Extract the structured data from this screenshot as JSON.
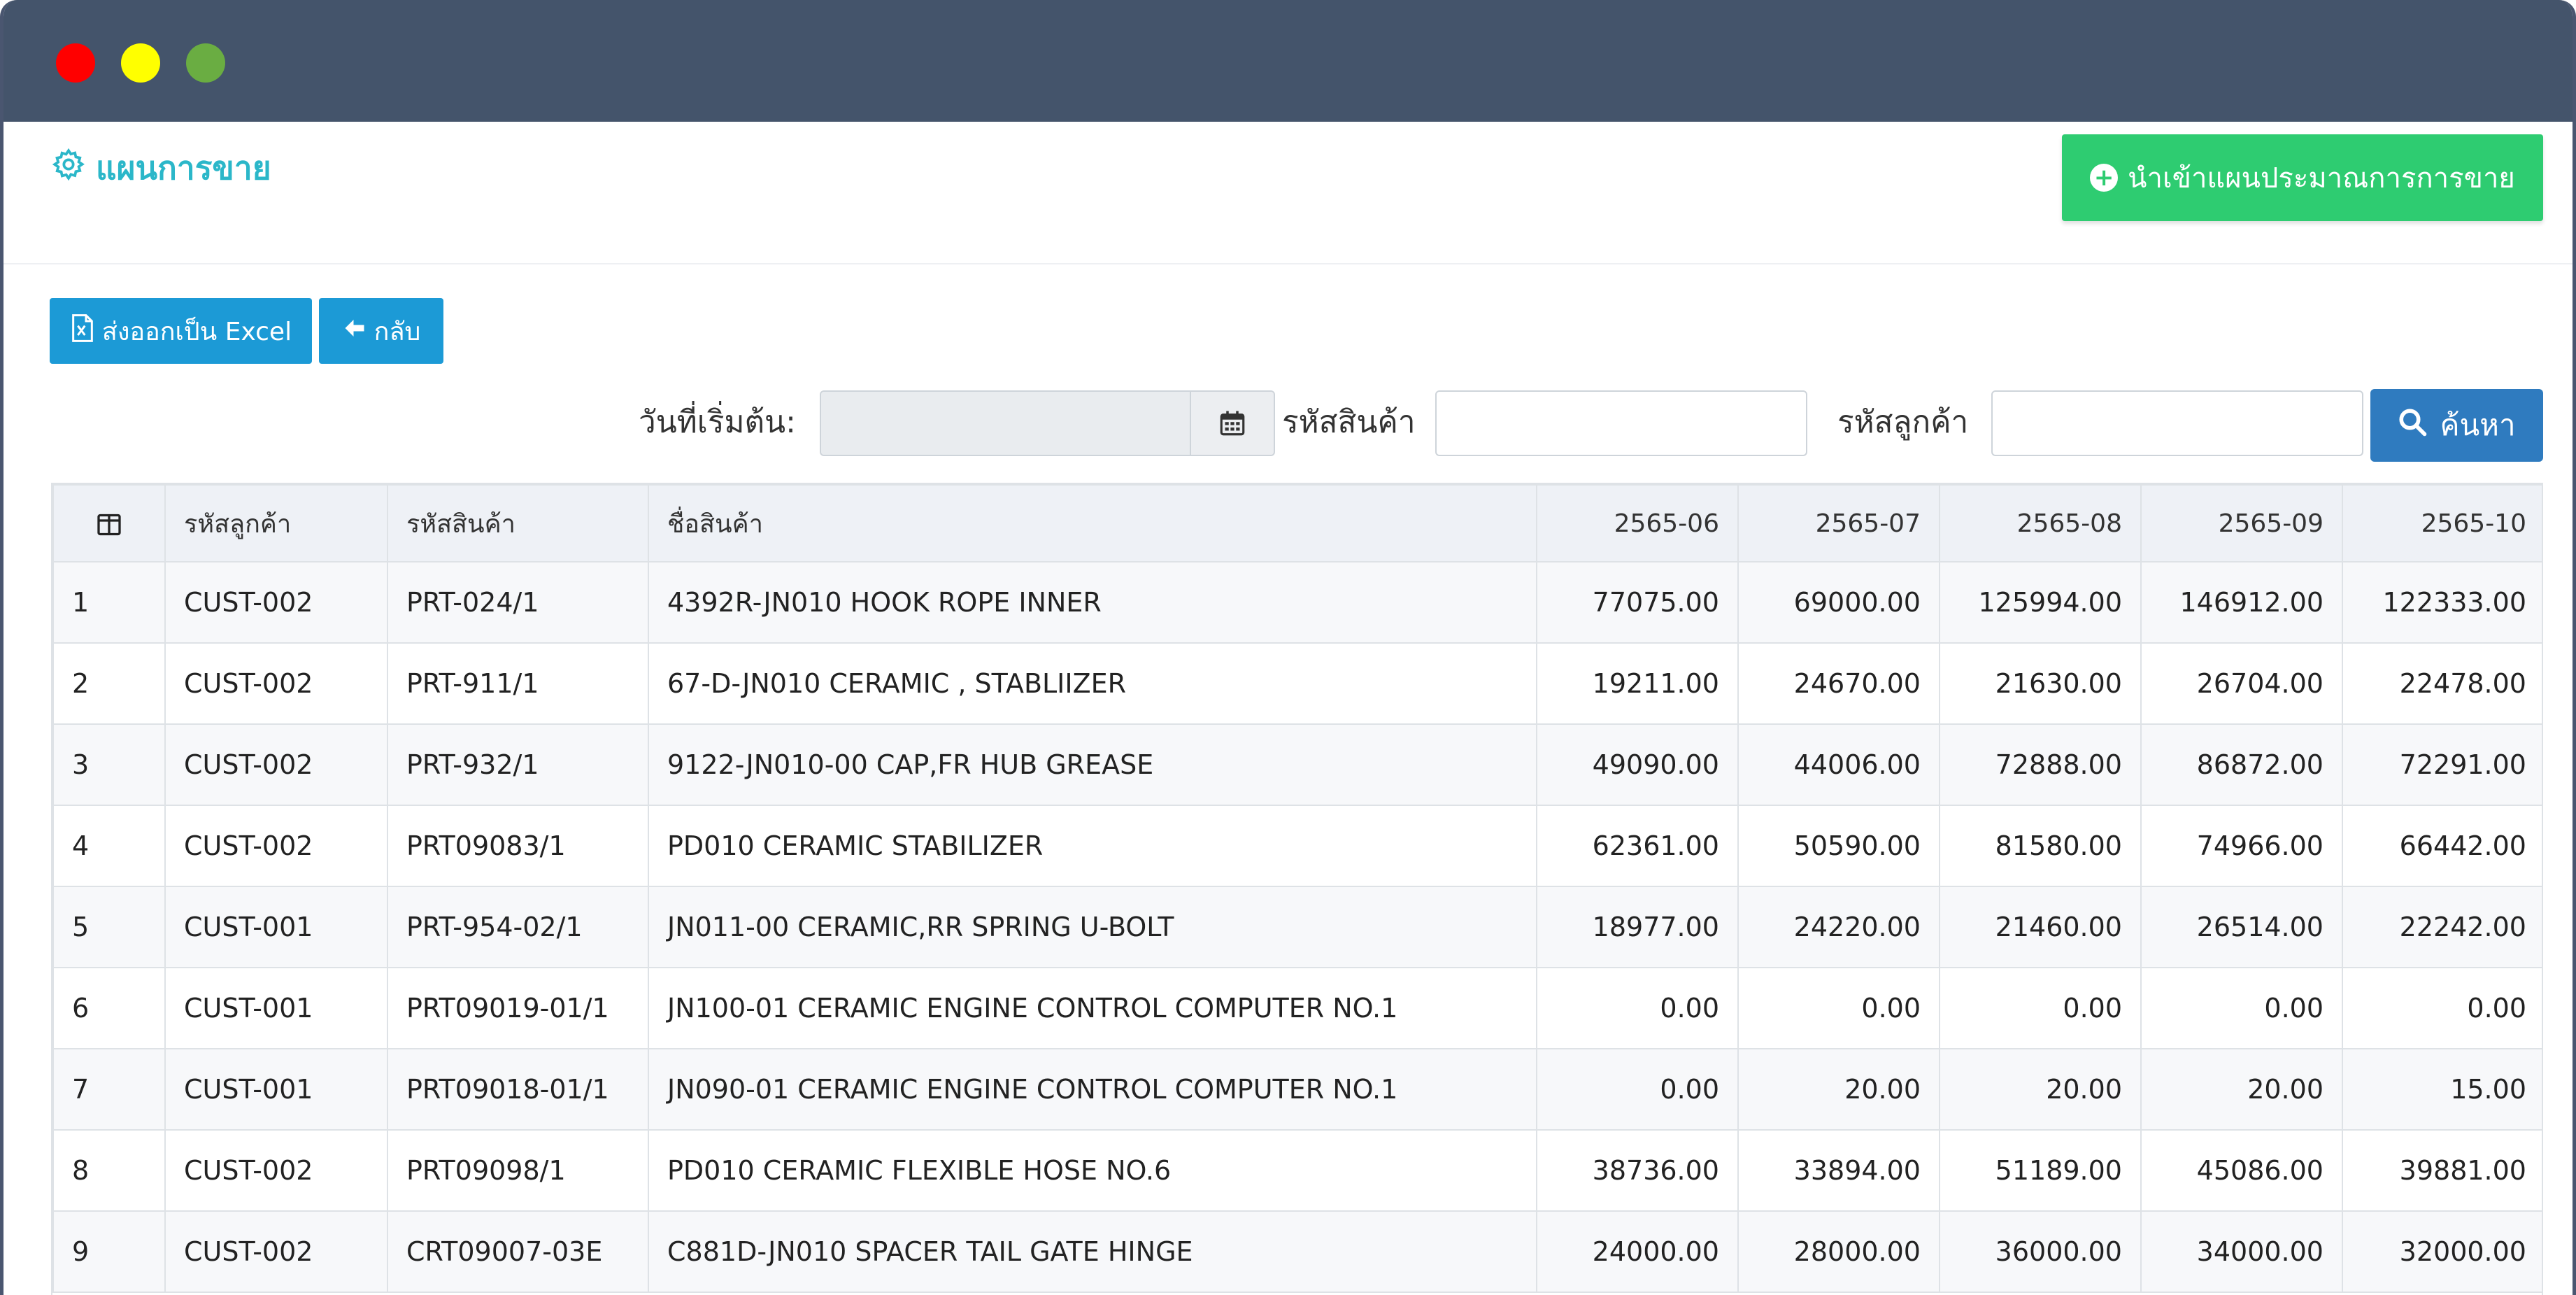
{
  "window": {
    "controls": [
      "close",
      "minimize",
      "zoom"
    ],
    "colors": {
      "close": "#ff0000",
      "minimize": "#ffff00",
      "zoom": "#6aad42",
      "titlebar": "#44546b"
    }
  },
  "header": {
    "title": "แผนการขาย",
    "title_icon": "gear-icon",
    "import_button": "นำเข้าแผนประมาณการการขาย"
  },
  "toolbar": {
    "export_button": "ส่งออกเป็น Excel",
    "back_button": "กลับ"
  },
  "filters": {
    "start_date_label": "วันที่เริ่มต้น:",
    "start_date_value": "",
    "product_code_label": "รหัสสินค้า",
    "product_code_value": "",
    "customer_code_label": "รหัสลูกค้า",
    "customer_code_value": "",
    "search_button": "ค้นหา"
  },
  "table": {
    "headers": [
      "",
      "รหัสลูกค้า",
      "รหัสสินค้า",
      "ชื่อสินค้า",
      "2565-06",
      "2565-07",
      "2565-08",
      "2565-09",
      "2565-10"
    ],
    "rows": [
      [
        "1",
        "CUST-002",
        "PRT-024/1",
        "4392R-JN010 HOOK ROPE INNER",
        "77075.00",
        "69000.00",
        "125994.00",
        "146912.00",
        "122333.00"
      ],
      [
        "2",
        "CUST-002",
        "PRT-911/1",
        "67-D-JN010 CERAMIC , STABLIIZER",
        "19211.00",
        "24670.00",
        "21630.00",
        "26704.00",
        "22478.00"
      ],
      [
        "3",
        "CUST-002",
        "PRT-932/1",
        "9122-JN010-00 CAP,FR HUB GREASE",
        "49090.00",
        "44006.00",
        "72888.00",
        "86872.00",
        "72291.00"
      ],
      [
        "4",
        "CUST-002",
        "PRT09083/1",
        "PD010 CERAMIC STABILIZER",
        "62361.00",
        "50590.00",
        "81580.00",
        "74966.00",
        "66442.00"
      ],
      [
        "5",
        "CUST-001",
        "PRT-954-02/1",
        "JN011-00 CERAMIC,RR SPRING U-BOLT",
        "18977.00",
        "24220.00",
        "21460.00",
        "26514.00",
        "22242.00"
      ],
      [
        "6",
        "CUST-001",
        "PRT09019-01/1",
        "JN100-01 CERAMIC ENGINE CONTROL COMPUTER NO.1",
        "0.00",
        "0.00",
        "0.00",
        "0.00",
        "0.00"
      ],
      [
        "7",
        "CUST-001",
        "PRT09018-01/1",
        "JN090-01 CERAMIC ENGINE CONTROL COMPUTER NO.1",
        "0.00",
        "20.00",
        "20.00",
        "20.00",
        "15.00"
      ],
      [
        "8",
        "CUST-002",
        "PRT09098/1",
        "PD010 CERAMIC FLEXIBLE HOSE NO.6",
        "38736.00",
        "33894.00",
        "51189.00",
        "45086.00",
        "39881.00"
      ],
      [
        "9",
        "CUST-002",
        "CRT09007-03E",
        "C881D-JN010 SPACER TAIL GATE HINGE",
        "24000.00",
        "28000.00",
        "36000.00",
        "34000.00",
        "32000.00"
      ]
    ]
  }
}
